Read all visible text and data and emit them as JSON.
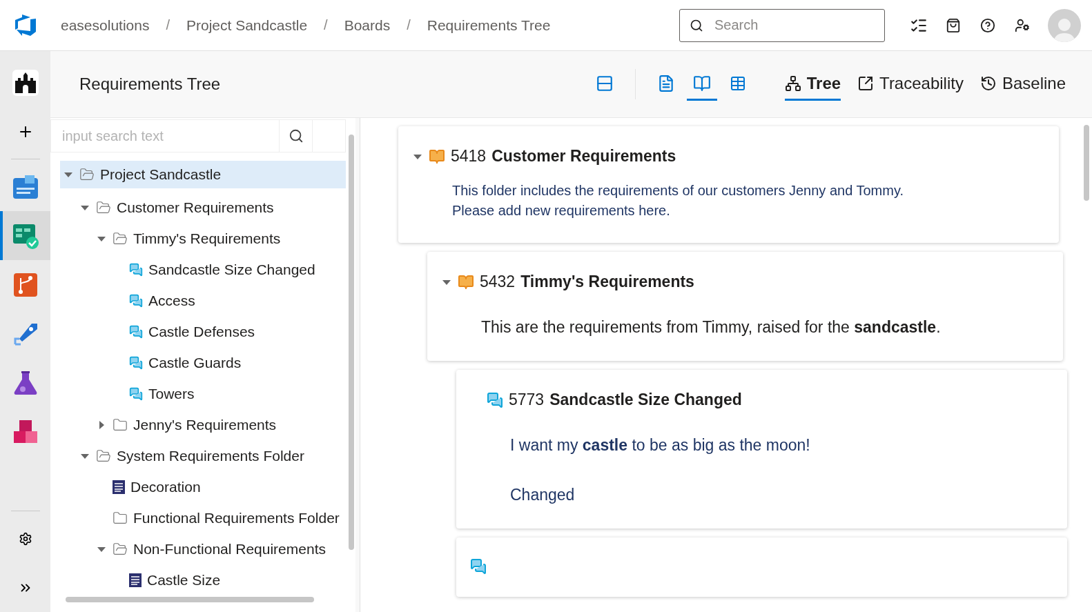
{
  "breadcrumbs": [
    "easesolutions",
    "Project Sandcastle",
    "Boards",
    "Requirements Tree"
  ],
  "breadcrumb_separators": [
    "/",
    "/",
    "/"
  ],
  "search": {
    "placeholder": "Search"
  },
  "rail": [
    {
      "kind": "project",
      "selected": false
    },
    {
      "kind": "add",
      "selected": false
    },
    {
      "kind": "overview",
      "selected": false
    },
    {
      "kind": "boards",
      "selected": true
    },
    {
      "kind": "repos",
      "selected": false
    },
    {
      "kind": "pipelines",
      "selected": false
    },
    {
      "kind": "tests",
      "selected": false
    },
    {
      "kind": "artifacts",
      "selected": false
    }
  ],
  "page_title": "Requirements Tree",
  "view_buttons": [
    {
      "kind": "cards",
      "selected": false
    },
    {
      "kind": "document",
      "selected": false
    },
    {
      "kind": "book",
      "selected": true
    },
    {
      "kind": "table",
      "selected": false
    }
  ],
  "tabs": [
    {
      "label": "Tree",
      "kind": "tree",
      "selected": true
    },
    {
      "label": "Traceability",
      "kind": "trace",
      "selected": false
    },
    {
      "label": "Baseline",
      "kind": "history",
      "selected": false
    }
  ],
  "tree_search": {
    "placeholder": "input search text"
  },
  "tree": [
    {
      "label": "Project Sandcastle",
      "kind": "folder",
      "expanded": true,
      "selected": true,
      "children": [
        {
          "label": "Customer Requirements",
          "kind": "folder",
          "expanded": true,
          "selected": false,
          "children": [
            {
              "label": "Timmy's Requirements",
              "kind": "folder",
              "expanded": true,
              "selected": false,
              "children": [
                {
                  "label": "Sandcastle Size Changed",
                  "kind": "requirement",
                  "selected": false
                },
                {
                  "label": "Access",
                  "kind": "requirement",
                  "selected": false
                },
                {
                  "label": "Castle Defenses",
                  "kind": "requirement",
                  "selected": false
                },
                {
                  "label": "Castle Guards",
                  "kind": "requirement",
                  "selected": false
                },
                {
                  "label": "Towers",
                  "kind": "requirement",
                  "selected": false
                }
              ]
            },
            {
              "label": "Jenny's Requirements",
              "kind": "folder",
              "expanded": false,
              "selected": false
            }
          ]
        },
        {
          "label": "System Requirements Folder",
          "kind": "folder",
          "expanded": true,
          "selected": false,
          "children": [
            {
              "label": "Decoration",
              "kind": "document",
              "selected": false
            },
            {
              "label": "Functional Requirements Folder",
              "kind": "folder",
              "selected": false
            },
            {
              "label": "Non-Functional Requirements",
              "kind": "folder",
              "expanded": true,
              "selected": false,
              "children": [
                {
                  "label": "Castle Size",
                  "kind": "document",
                  "selected": false
                }
              ]
            }
          ]
        }
      ]
    }
  ],
  "cards": [
    {
      "id": "5418",
      "title": "Customer Requirements",
      "kind": "folder",
      "expanded": true,
      "body": [
        "This folder includes the requirements of our customers Jenny and Tommy.",
        "Please add new requirements here."
      ],
      "children": [
        {
          "id": "5432",
          "title": "Timmy's Requirements",
          "kind": "folder",
          "expanded": true,
          "body": [
            "This are the requirements from Timmy, raised for the **sandcastle**."
          ],
          "children": [
            {
              "id": "5773",
              "title": "Sandcastle Size Changed",
              "kind": "requirement",
              "body": [
                "I want my **castle** to be as big as the moon!",
                "Changed"
              ]
            },
            {
              "kind": "requirement"
            }
          ]
        }
      ]
    }
  ]
}
